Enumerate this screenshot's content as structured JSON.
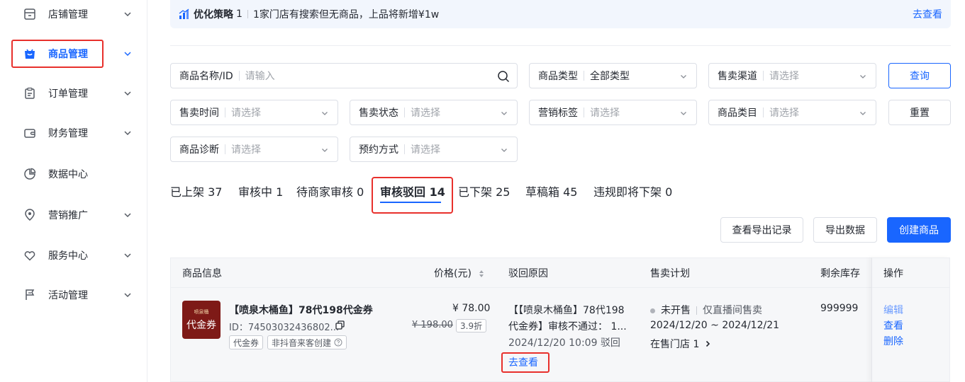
{
  "sidebar": {
    "items": [
      {
        "label": "店铺管理",
        "icon": "store-icon"
      },
      {
        "label": "商品管理",
        "icon": "product-bag-icon"
      },
      {
        "label": "订单管理",
        "icon": "order-clipboard-icon"
      },
      {
        "label": "财务管理",
        "icon": "wallet-icon"
      },
      {
        "label": "数据中心",
        "icon": "pie-chart-icon"
      },
      {
        "label": "营销推广",
        "icon": "location-pin-icon"
      },
      {
        "label": "服务中心",
        "icon": "heart-icon"
      },
      {
        "label": "活动管理",
        "icon": "flag-icon"
      }
    ],
    "active_index": 1
  },
  "banner": {
    "title": "优化策略",
    "count": "1",
    "text": "1家门店有搜索但无商品，上品将新增¥1w",
    "link": "去查看"
  },
  "filters": {
    "name": {
      "label": "商品名称/ID",
      "placeholder": "请输入"
    },
    "type": {
      "label": "商品类型",
      "value": "全部类型"
    },
    "channel": {
      "label": "售卖渠道",
      "placeholder": "请选择"
    },
    "sale_time": {
      "label": "售卖时间",
      "placeholder": "请选择"
    },
    "sale_status": {
      "label": "售卖状态",
      "placeholder": "请选择"
    },
    "marketing_tag": {
      "label": "营销标签",
      "placeholder": "请选择"
    },
    "category": {
      "label": "商品类目",
      "placeholder": "请选择"
    },
    "diagnosis": {
      "label": "商品诊断",
      "placeholder": "请选择"
    },
    "booking": {
      "label": "预约方式",
      "placeholder": "请选择"
    },
    "query_button": "查询",
    "reset_button": "重置"
  },
  "tabs": [
    {
      "label": "已上架 37"
    },
    {
      "label": "审核中 1"
    },
    {
      "label": "待商家审核 0"
    },
    {
      "label": "审核驳回 14"
    },
    {
      "label": "已下架 25"
    },
    {
      "label": "草稿箱 45"
    },
    {
      "label": "违规即将下架 0"
    }
  ],
  "actions": {
    "export_records": "查看导出记录",
    "export_data": "导出数据",
    "create_product": "创建商品"
  },
  "table": {
    "headers": {
      "info": "商品信息",
      "price": "价格(元)",
      "reason": "驳回原因",
      "plan": "售卖计划",
      "stock": "剩余库存",
      "ops": "操作"
    },
    "row": {
      "thumb_brand": "喷泉桶",
      "thumb_text": "代金券",
      "title": "【喷泉木桶鱼】78代198代金券",
      "id": "ID：74503032436802...",
      "tag1": "代金券",
      "tag2": "非抖音来客创建",
      "price": "¥ 78.00",
      "original_price": "¥ 198.00",
      "discount": "3.9折",
      "reason_line1": "【【喷泉木桶鱼】78代198",
      "reason_line2": "代金券】审核不通过： 1...",
      "reason_time": "2024/12/20 10:09 驳回",
      "reason_link": "去查看",
      "plan_status": "未开售",
      "plan_channel": "仅直播间售卖",
      "plan_dates": "2024/12/20 ~ 2024/12/21",
      "plan_stores": "在售门店 1",
      "stock": "999999",
      "op_edit": "编辑",
      "op_view": "查看",
      "op_delete": "删除"
    }
  }
}
